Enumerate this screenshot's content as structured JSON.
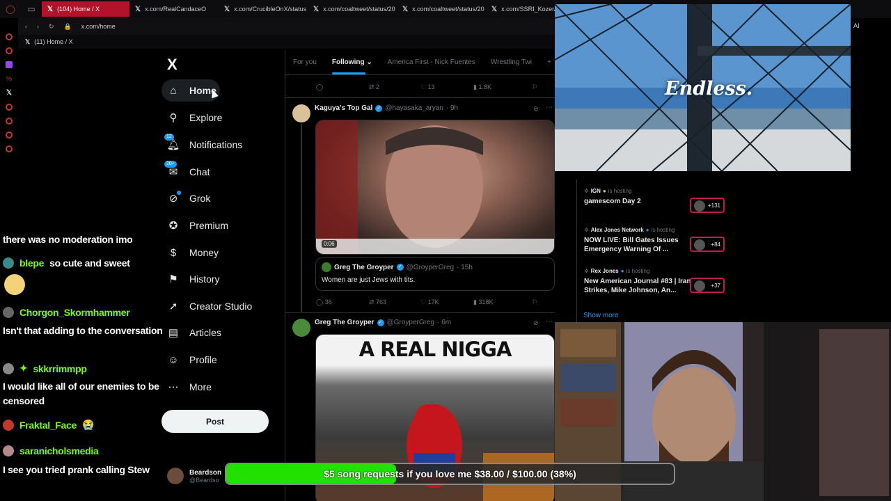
{
  "browser": {
    "tabs": [
      {
        "label": "(104) Home / X",
        "active": true
      },
      {
        "label": "x.com/RealCandaceO",
        "active": false
      },
      {
        "label": "x.com/CrucibleOnX/status",
        "active": false
      },
      {
        "label": "x.com/coaltweet/status/20",
        "active": false
      },
      {
        "label": "x.com/coaltweet/status/20",
        "active": false
      },
      {
        "label": "x.com/SSRI_Kozer/stat",
        "active": false
      }
    ],
    "url": "x.com/home",
    "bookmark": "(11) Home / X",
    "ai_label": "AI"
  },
  "nav": {
    "logo": "X",
    "items": [
      {
        "label": "Home",
        "icon": "home-icon"
      },
      {
        "label": "Explore",
        "icon": "search-icon"
      },
      {
        "label": "Notifications",
        "icon": "bell-icon",
        "badge": "12"
      },
      {
        "label": "Chat",
        "icon": "chat-icon",
        "badge": "20+"
      },
      {
        "label": "Grok",
        "icon": "grok-icon"
      },
      {
        "label": "Premium",
        "icon": "premium-icon"
      },
      {
        "label": "Money",
        "icon": "money-icon"
      },
      {
        "label": "History",
        "icon": "bookmark-icon"
      },
      {
        "label": "Creator Studio",
        "icon": "rocket-icon"
      },
      {
        "label": "Articles",
        "icon": "article-icon"
      },
      {
        "label": "Profile",
        "icon": "person-icon"
      },
      {
        "label": "More",
        "icon": "more-icon"
      }
    ],
    "post_label": "Post",
    "account_name": "Beardson",
    "account_handle": "@Beardso"
  },
  "timeline": {
    "tabs": [
      "For you",
      "Following",
      "America First - Nick Fuentes",
      "Wrestling Twi",
      "+"
    ],
    "top_actions": {
      "replies": "",
      "reposts": "2",
      "likes": "13",
      "views": "1.8K"
    },
    "tweet1": {
      "name": "Kaguya's Top Gal",
      "handle": "@hayasaka_aryan",
      "time": "· 9h",
      "video_time": "0:06",
      "quote": {
        "name": "Greg The Groyper",
        "handle": "@GroyperGreg",
        "time": "· 15h",
        "text": "Women are just Jews with tits."
      },
      "actions": {
        "replies": "36",
        "reposts": "763",
        "likes": "17K",
        "views": "318K"
      }
    },
    "tweet2": {
      "name": "Greg The Groyper",
      "handle": "@GroyperGreg",
      "time": "· 6m",
      "meme_text": "A REAL NIGGA"
    }
  },
  "spaces": {
    "items": [
      {
        "host": "IGN",
        "status": "is hosting",
        "title": "gamescom Day 2",
        "count": "+131"
      },
      {
        "host": "Alex Jones Network",
        "status": "is hosting",
        "title": "NOW LIVE: Bill Gates Issues Emergency Warning Of ...",
        "count": "+84"
      },
      {
        "host": "Rex Jones",
        "status": "is hosting",
        "title": "New American Journal #83 | Iran Strikes, Mike Johnson, An...",
        "count": "+37"
      }
    ],
    "show_more": "Show more"
  },
  "stream": {
    "bridge_caption": "Endless.",
    "goal_text": "$5 song requests if you love me $38.00 / $100.00 (38%)",
    "goal_progress": 0.38
  },
  "chat": {
    "line0": "there was no moderation imo",
    "m1": {
      "user": "blepe",
      "text": "so cute and sweet"
    },
    "m2": {
      "user": "Chorgon_Skormhammer",
      "text": "Isn't that adding to the conversation"
    },
    "m3": {
      "user": "skkrrimmpp",
      "text": "I would like all of our enemies to be censored"
    },
    "m4": {
      "user": "Fraktal_Face",
      "emoji": "😭"
    },
    "m5": {
      "user": "saranicholsmedia",
      "text": "I see you tried prank calling Stew"
    }
  },
  "colors": {
    "accent": "#1d9bf0",
    "chat_user": "#7cfc00",
    "goal_fill": "#22e000",
    "tab_active": "#b3132a"
  }
}
